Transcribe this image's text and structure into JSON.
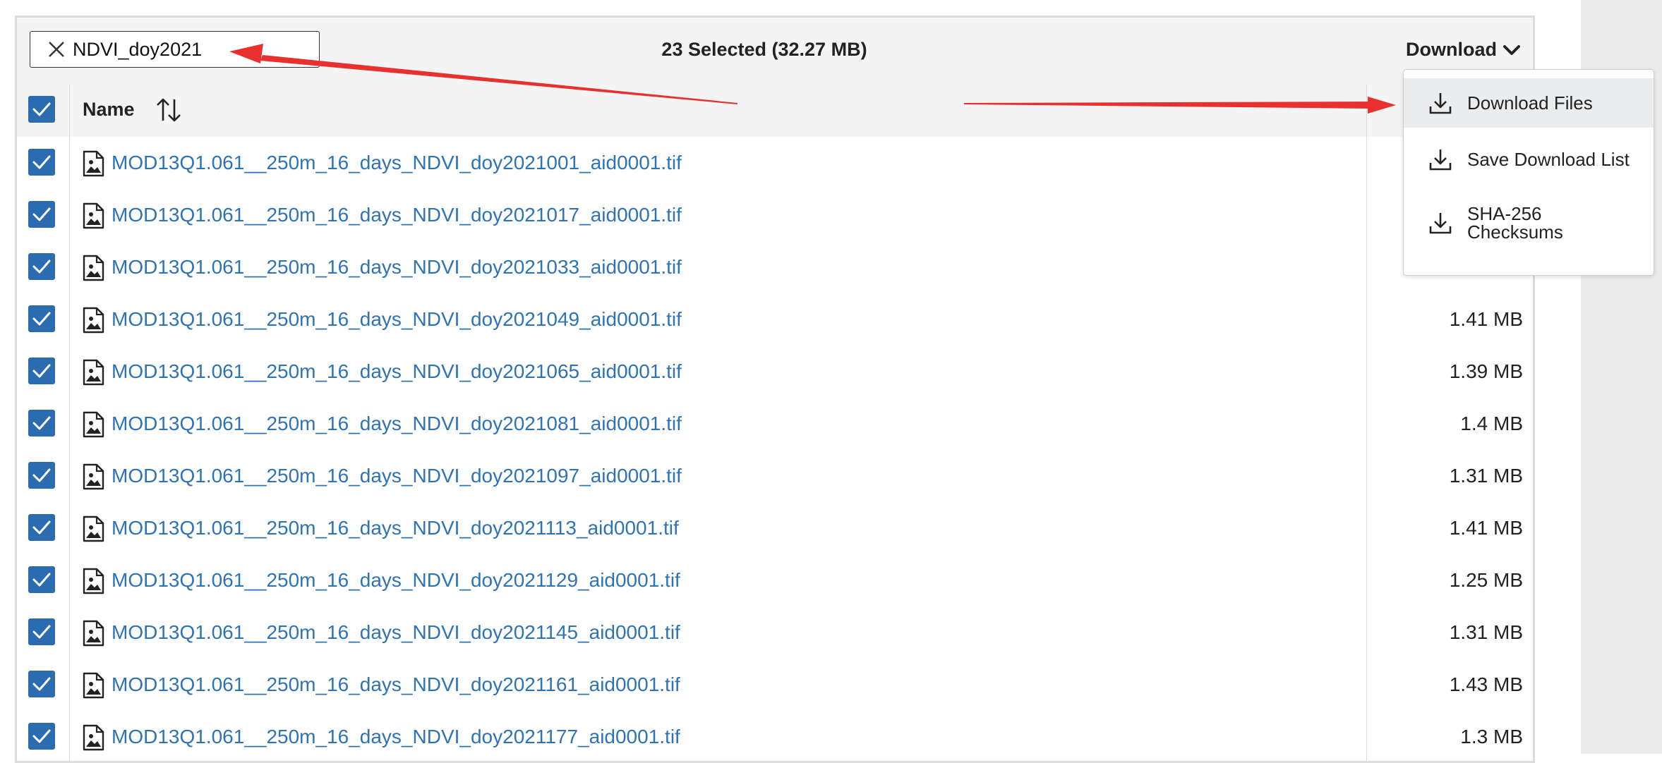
{
  "filter": {
    "value": "NDVI_doy2021"
  },
  "toolbar": {
    "selected_summary": "23 Selected (32.27 MB)",
    "download_label": "Download"
  },
  "table": {
    "header_name": "Name",
    "rows": [
      {
        "name": "MOD13Q1.061__250m_16_days_NDVI_doy2021001_aid0001.tif",
        "size": ""
      },
      {
        "name": "MOD13Q1.061__250m_16_days_NDVI_doy2021017_aid0001.tif",
        "size": ""
      },
      {
        "name": "MOD13Q1.061__250m_16_days_NDVI_doy2021033_aid0001.tif",
        "size": ""
      },
      {
        "name": "MOD13Q1.061__250m_16_days_NDVI_doy2021049_aid0001.tif",
        "size": "1.41 MB"
      },
      {
        "name": "MOD13Q1.061__250m_16_days_NDVI_doy2021065_aid0001.tif",
        "size": "1.39 MB"
      },
      {
        "name": "MOD13Q1.061__250m_16_days_NDVI_doy2021081_aid0001.tif",
        "size": "1.4 MB"
      },
      {
        "name": "MOD13Q1.061__250m_16_days_NDVI_doy2021097_aid0001.tif",
        "size": "1.31 MB"
      },
      {
        "name": "MOD13Q1.061__250m_16_days_NDVI_doy2021113_aid0001.tif",
        "size": "1.41 MB"
      },
      {
        "name": "MOD13Q1.061__250m_16_days_NDVI_doy2021129_aid0001.tif",
        "size": "1.25 MB"
      },
      {
        "name": "MOD13Q1.061__250m_16_days_NDVI_doy2021145_aid0001.tif",
        "size": "1.31 MB"
      },
      {
        "name": "MOD13Q1.061__250m_16_days_NDVI_doy2021161_aid0001.tif",
        "size": "1.43 MB"
      },
      {
        "name": "MOD13Q1.061__250m_16_days_NDVI_doy2021177_aid0001.tif",
        "size": "1.3 MB"
      }
    ]
  },
  "download_menu": {
    "items": [
      {
        "label": "Download Files",
        "icon": "download-icon"
      },
      {
        "label": "Save Download List",
        "icon": "download-icon"
      },
      {
        "label": "SHA-256 Checksums",
        "icon": "download-icon"
      }
    ]
  },
  "colors": {
    "link": "#2f73b7",
    "checkbox": "#2b6cb0",
    "annotation_arrow": "#e8302f"
  }
}
